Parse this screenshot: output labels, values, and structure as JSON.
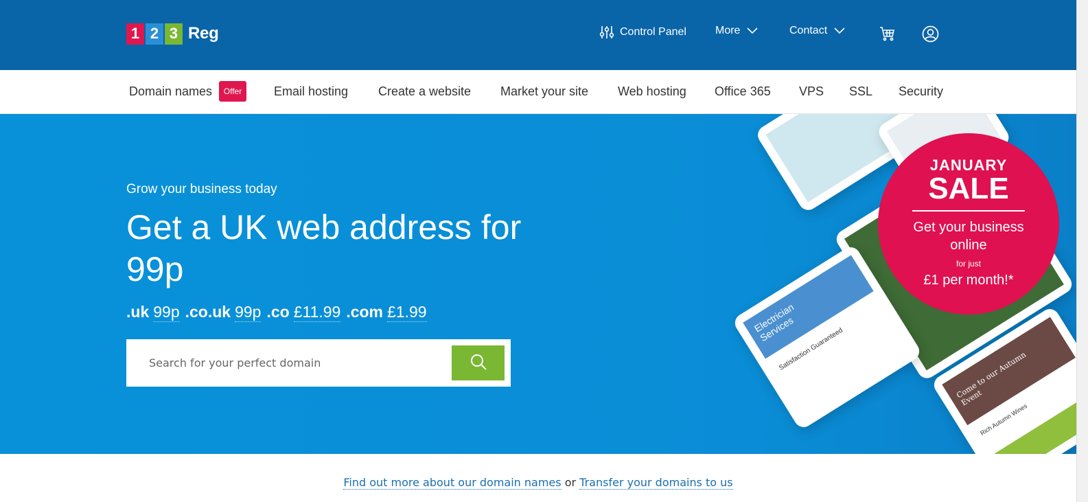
{
  "brand": {
    "logo_digits": [
      "1",
      "2",
      "3"
    ],
    "logo_word": "Reg",
    "colors": {
      "header_blue": "#0a64a8",
      "hero_blue": "#0891d9",
      "accent_red": "#e0164f",
      "accent_green": "#7ab733"
    }
  },
  "top_nav": {
    "control_panel": {
      "label": "Control Panel",
      "icon": "sliders-icon"
    },
    "more": {
      "label": "More",
      "icon": "chevron-down-icon"
    },
    "contact": {
      "label": "Contact",
      "icon": "chevron-down-icon"
    },
    "cart": {
      "icon": "cart-icon"
    },
    "account": {
      "icon": "user-circle-icon"
    }
  },
  "sub_nav": {
    "items": [
      "Domain names",
      "Email hosting",
      "Create a website",
      "Market your site",
      "Web hosting",
      "Office 365",
      "VPS",
      "SSL",
      "Security"
    ],
    "offer_badge": "Offer"
  },
  "hero": {
    "kicker": "Grow your business today",
    "headline": "Get a UK web address for 99p",
    "prices": [
      {
        "tld": ".uk",
        "price": "99p"
      },
      {
        "tld": ".co.uk",
        "price": "99p"
      },
      {
        "tld": ".co",
        "price": "£11.99"
      },
      {
        "tld": ".com",
        "price": "£1.99"
      }
    ],
    "search": {
      "placeholder": "Search for your perfect domain",
      "button_icon": "search-icon"
    }
  },
  "sale_badge": {
    "line1": "JANUARY",
    "line2": "SALE",
    "line3": "Get your business online",
    "line4": "for just",
    "line5": "£1 per month!*"
  },
  "device_mockups": {
    "tablet_1_title": "Electrician Services",
    "tablet_1_sub": "Satisfaction Guaranteed",
    "tablet_2_title": "Come to our Autumn Event",
    "tablet_2_sub": "Rich Autumn Wines"
  },
  "footer_links": {
    "link1": "Find out more about our domain names",
    "connector": "or",
    "link2": "Transfer your domains to us"
  }
}
